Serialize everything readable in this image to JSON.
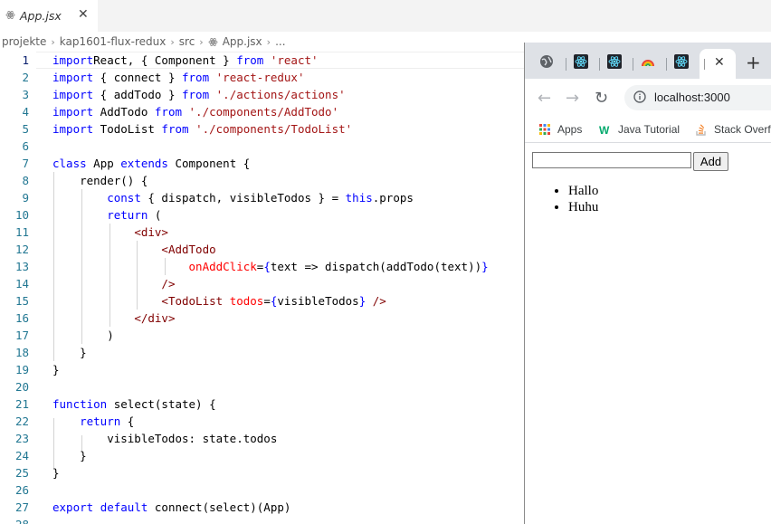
{
  "editor": {
    "tab": {
      "label": "App.jsx",
      "close": "✕"
    },
    "breadcrumb": [
      "projekte",
      "kap1601-flux-redux",
      "src",
      "App.jsx",
      "..."
    ],
    "breadcrumb_sep": "›",
    "lines": [
      {
        "n": "1",
        "active": true,
        "tokens": [
          [
            "kw",
            "import"
          ],
          [
            "",
            "React, { Component } "
          ],
          [
            "kw",
            "from"
          ],
          [
            "",
            " "
          ],
          [
            "str",
            "'react'"
          ]
        ]
      },
      {
        "n": "2",
        "tokens": [
          [
            "kw",
            "import"
          ],
          [
            "",
            " { connect } "
          ],
          [
            "kw",
            "from"
          ],
          [
            "",
            " "
          ],
          [
            "str",
            "'react-redux'"
          ]
        ]
      },
      {
        "n": "3",
        "tokens": [
          [
            "kw",
            "import"
          ],
          [
            "",
            " { addTodo } "
          ],
          [
            "kw",
            "from"
          ],
          [
            "",
            " "
          ],
          [
            "str",
            "'./actions/actions'"
          ]
        ]
      },
      {
        "n": "4",
        "tokens": [
          [
            "kw",
            "import"
          ],
          [
            "",
            " AddTodo "
          ],
          [
            "kw",
            "from"
          ],
          [
            "",
            " "
          ],
          [
            "str",
            "'./components/AddTodo'"
          ]
        ]
      },
      {
        "n": "5",
        "tokens": [
          [
            "kw",
            "import"
          ],
          [
            "",
            " TodoList "
          ],
          [
            "kw",
            "from"
          ],
          [
            "",
            " "
          ],
          [
            "str",
            "'./components/TodoList'"
          ]
        ]
      },
      {
        "n": "6",
        "tokens": []
      },
      {
        "n": "7",
        "tokens": [
          [
            "kw",
            "class"
          ],
          [
            "",
            " App "
          ],
          [
            "kw",
            "extends"
          ],
          [
            "",
            " Component {"
          ]
        ]
      },
      {
        "n": "8",
        "tokens": [
          [
            "",
            "    render() {"
          ]
        ]
      },
      {
        "n": "9",
        "tokens": [
          [
            "",
            "        "
          ],
          [
            "kw",
            "const"
          ],
          [
            "",
            " { dispatch, visibleTodos } = "
          ],
          [
            "kw",
            "this"
          ],
          [
            "",
            ".props"
          ]
        ]
      },
      {
        "n": "10",
        "tokens": [
          [
            "",
            "        "
          ],
          [
            "kw",
            "return"
          ],
          [
            "",
            " ("
          ]
        ]
      },
      {
        "n": "11",
        "tokens": [
          [
            "",
            "            "
          ],
          [
            "tag",
            "<div>"
          ]
        ]
      },
      {
        "n": "12",
        "tokens": [
          [
            "",
            "                "
          ],
          [
            "tag",
            "<AddTodo"
          ]
        ]
      },
      {
        "n": "13",
        "tokens": [
          [
            "",
            "                    "
          ],
          [
            "attr",
            "onAddClick"
          ],
          [
            "",
            "="
          ],
          [
            "kw",
            "{"
          ],
          [
            "",
            "text => dispatch(addTodo(text))"
          ],
          [
            "kw",
            "}"
          ]
        ]
      },
      {
        "n": "14",
        "tokens": [
          [
            "",
            "                "
          ],
          [
            "tag",
            "/>"
          ]
        ]
      },
      {
        "n": "15",
        "tokens": [
          [
            "",
            "                "
          ],
          [
            "tag",
            "<TodoList"
          ],
          [
            "",
            " "
          ],
          [
            "attr",
            "todos"
          ],
          [
            "",
            "="
          ],
          [
            "kw",
            "{"
          ],
          [
            "",
            "visibleTodos"
          ],
          [
            "kw",
            "}"
          ],
          [
            "",
            " "
          ],
          [
            "tag",
            "/>"
          ]
        ]
      },
      {
        "n": "16",
        "tokens": [
          [
            "",
            "            "
          ],
          [
            "tag",
            "</div>"
          ]
        ]
      },
      {
        "n": "17",
        "tokens": [
          [
            "",
            "        )"
          ]
        ]
      },
      {
        "n": "18",
        "tokens": [
          [
            "",
            "    }"
          ]
        ]
      },
      {
        "n": "19",
        "tokens": [
          [
            "",
            "}"
          ]
        ]
      },
      {
        "n": "20",
        "tokens": []
      },
      {
        "n": "21",
        "tokens": [
          [
            "kw",
            "function"
          ],
          [
            "",
            " select(state) {"
          ]
        ]
      },
      {
        "n": "22",
        "tokens": [
          [
            "",
            "    "
          ],
          [
            "kw",
            "return"
          ],
          [
            "",
            " {"
          ]
        ]
      },
      {
        "n": "23",
        "tokens": [
          [
            "",
            "        visibleTodos: state.todos"
          ]
        ]
      },
      {
        "n": "24",
        "tokens": [
          [
            "",
            "    }"
          ]
        ]
      },
      {
        "n": "25",
        "tokens": [
          [
            "",
            "}"
          ]
        ]
      },
      {
        "n": "26",
        "tokens": []
      },
      {
        "n": "27",
        "tokens": [
          [
            "kw",
            "export"
          ],
          [
            "",
            " "
          ],
          [
            "kw",
            "default"
          ],
          [
            "",
            " connect(select)(App)"
          ]
        ]
      },
      {
        "n": "28",
        "tokens": []
      }
    ]
  },
  "browser": {
    "active_tab_close": "✕",
    "new_tab": "+",
    "back": "←",
    "forward": "→",
    "reload": "↻",
    "url": "localhost:3000",
    "bookmarks": [
      "Apps",
      "Java Tutorial",
      "Stack Overfl"
    ],
    "app": {
      "input_value": "",
      "add_label": "Add",
      "todos": [
        "Hallo",
        "Huhu"
      ]
    }
  },
  "colors": {
    "keyword": "#0000ff",
    "string": "#a31515",
    "tag": "#800000",
    "attribute": "#ff0000",
    "line_number": "#237893"
  }
}
